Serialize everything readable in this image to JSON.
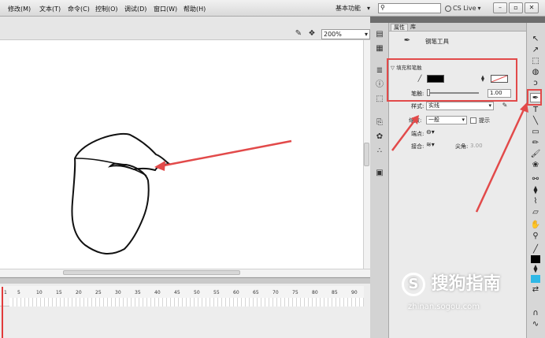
{
  "menu": {
    "items": [
      "修改(M)",
      "文本(T)",
      "命令(C)",
      "控制(O)",
      "调试(D)",
      "窗口(W)",
      "帮助(H)"
    ],
    "workspace": "基本功能",
    "search_placeholder": "",
    "cs_live": "CS Live"
  },
  "window_controls": {
    "minimize": "–",
    "restore": "▫",
    "close": "✕"
  },
  "stage": {
    "zoom": "200%"
  },
  "timeline": {
    "ticks": [
      "1",
      "5",
      "10",
      "15",
      "20",
      "25",
      "30",
      "35",
      "40",
      "45",
      "50",
      "55",
      "60",
      "65",
      "70",
      "75",
      "80",
      "85",
      "90"
    ]
  },
  "panel": {
    "tab_properties": "属性",
    "tab_library": "库",
    "tool_name": "钢笔工具",
    "section_fill_stroke": "填充和笔触",
    "stroke_label": "笔触:",
    "stroke_value": "1.00",
    "style_label": "样式:",
    "style_value": "实线",
    "scale_label": "缩放:",
    "scale_value": "一般",
    "hint_label": "提示",
    "cap_label": "端点:",
    "join_label": "接合:",
    "miter_label": "尖角:",
    "miter_value": "3.00",
    "stroke_color": "#000000",
    "fill_color": "none"
  },
  "watermark": {
    "main": "搜狗指南",
    "sub": "zhinan.sogou.com"
  },
  "annotation_color": "#e24a4a"
}
